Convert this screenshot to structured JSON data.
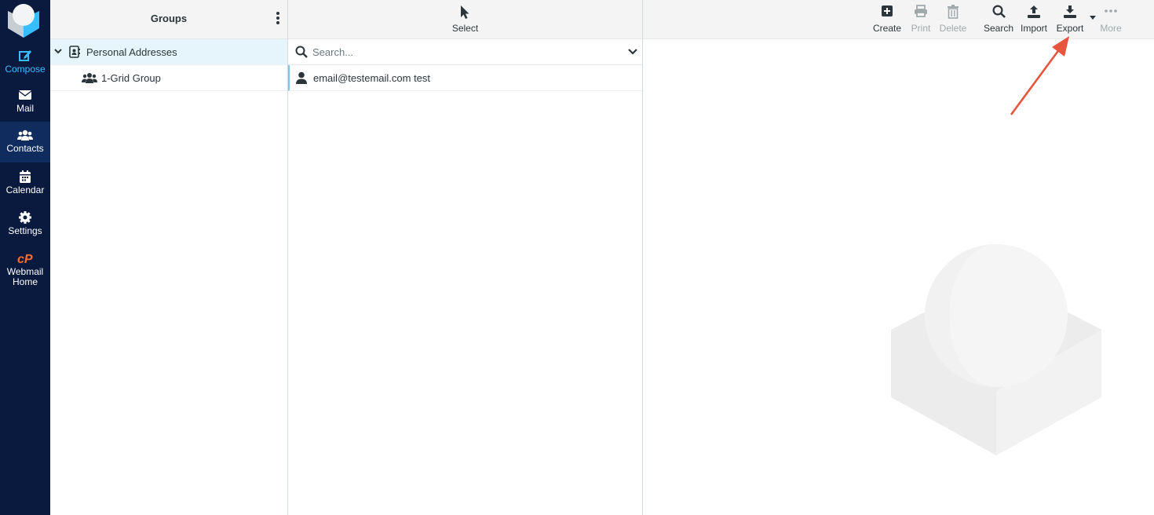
{
  "nav": {
    "compose": "Compose",
    "mail": "Mail",
    "contacts": "Contacts",
    "calendar": "Calendar",
    "settings": "Settings",
    "webmail_home_line1": "Webmail",
    "webmail_home_line2": "Home"
  },
  "groups": {
    "title": "Groups",
    "addressbook": "Personal Addresses",
    "group_item": "1-Grid Group"
  },
  "list": {
    "select_label": "Select",
    "search_placeholder": "Search...",
    "contacts": [
      "email@testemail.com test"
    ]
  },
  "toolbar": {
    "create": "Create",
    "print": "Print",
    "delete": "Delete",
    "search": "Search",
    "import": "Import",
    "export": "Export",
    "more": "More"
  },
  "colors": {
    "nav_bg": "#0a1a3f",
    "accent": "#37beff",
    "annotation_arrow": "#e8553e"
  }
}
